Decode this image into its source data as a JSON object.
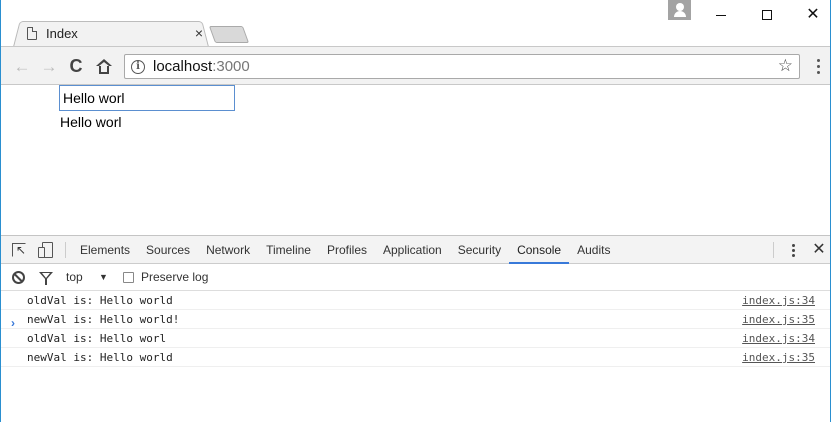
{
  "browser": {
    "tab_title": "Index",
    "tab_close": "×",
    "url_host": "localhost",
    "url_port": ":3000",
    "back": "←",
    "forward": "→",
    "reload": "C",
    "info": "i",
    "star": "☆",
    "window_close": "✕"
  },
  "page": {
    "input_value": "Hello worl",
    "echo_text": "Hello worl"
  },
  "devtools": {
    "tabs": [
      "Elements",
      "Sources",
      "Network",
      "Timeline",
      "Profiles",
      "Application",
      "Security",
      "Console",
      "Audits"
    ],
    "active_tab": "Console",
    "close": "✕",
    "context": "top",
    "context_arrow": "▼",
    "preserve_log_label": "Preserve log",
    "prompt": "›",
    "logs": [
      {
        "message": "oldVal is: Hello world",
        "source": "index.js:34"
      },
      {
        "message": "newVal is: Hello world!",
        "source": "index.js:35"
      },
      {
        "message": "oldVal is: Hello worl",
        "source": "index.js:34"
      },
      {
        "message": "newVal is: Hello world",
        "source": "index.js:35"
      }
    ]
  },
  "colors": {
    "accent": "#3879d9",
    "window_border": "#2a8fd0"
  }
}
